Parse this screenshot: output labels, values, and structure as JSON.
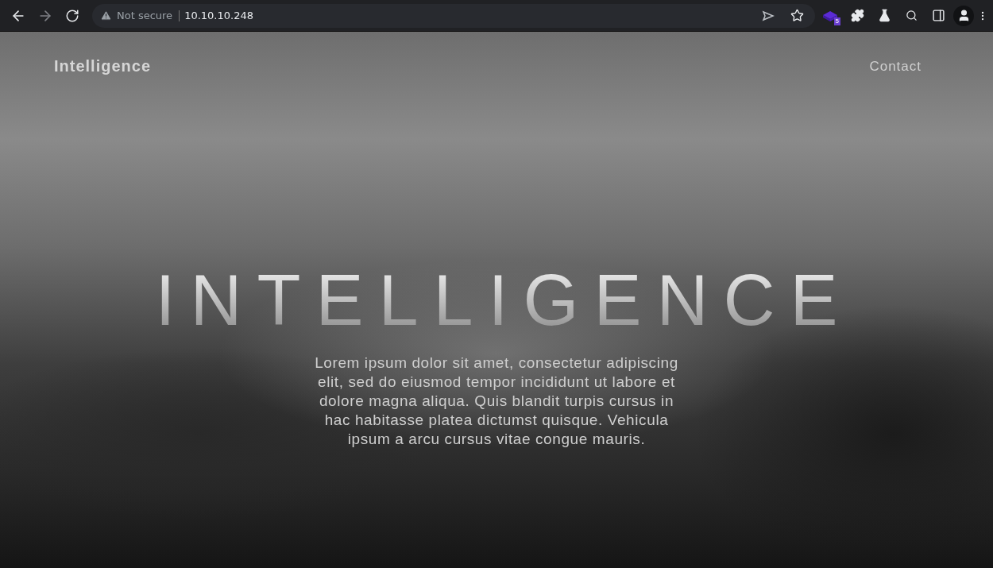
{
  "browser": {
    "nav_buttons": [
      {
        "kind": "back",
        "disabled": false
      },
      {
        "kind": "forward",
        "disabled": true
      },
      {
        "kind": "reload",
        "disabled": false
      }
    ],
    "security_label": "Not secure",
    "url": "10.10.10.248",
    "extension_badge": "5"
  },
  "site": {
    "brand": "Intelligence",
    "nav_link": "Contact",
    "title": "INTELLIGENCE",
    "intro": "Lorem ipsum dolor sit amet, consectetur adipiscing elit, sed do eiusmod tempor incididunt ut labore et dolore magna aliqua. Quis blandit turpis cursus in hac habitasse platea dictumst quisque. Vehicula ipsum a arcu cursus vitae congue mauris."
  }
}
